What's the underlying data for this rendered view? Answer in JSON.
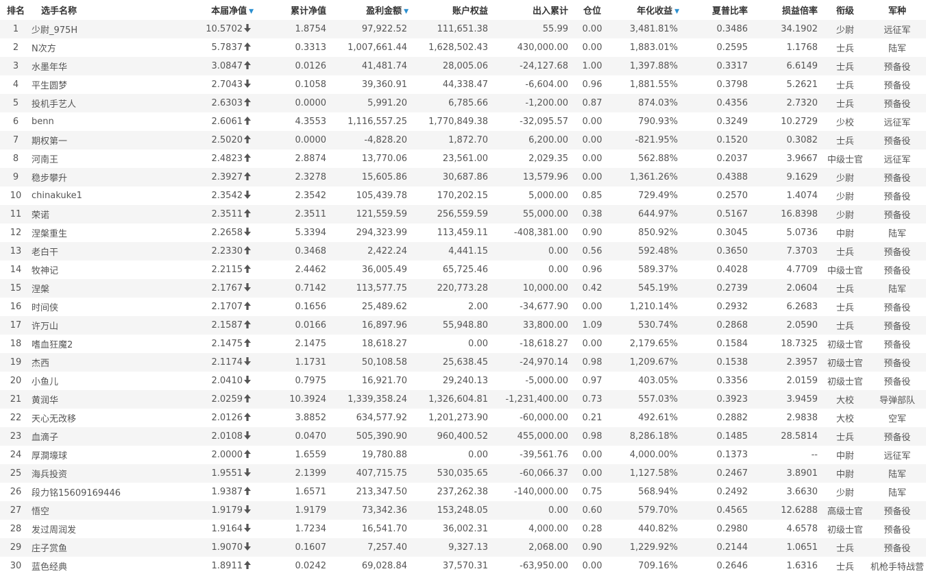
{
  "columns": {
    "rank": "排名",
    "name": "选手名称",
    "nav": "本届净值",
    "cum_nav": "累计净值",
    "profit": "盈利金额",
    "equity": "账户权益",
    "flow": "出入累计",
    "position": "仓位",
    "annual": "年化收益",
    "sharpe": "夏普比率",
    "pl_ratio": "损益倍率",
    "rank_title": "衔级",
    "army": "军种"
  },
  "colors": {
    "up": "#cc1111",
    "down": "#22a022",
    "sort": "#2a8fd0",
    "stripe": "#f5f5f5"
  },
  "rows": [
    {
      "rank": "1",
      "name": "少尉_975H",
      "nav": "10.5702",
      "dir": "down",
      "cum": "1.8754",
      "profit": "97,922.52",
      "equity": "111,651.38",
      "flow": "55.99",
      "pos": "0.00",
      "annual": "3,481.81%",
      "sharpe": "0.3486",
      "pl": "34.1902",
      "title": "少尉",
      "army": "远征军"
    },
    {
      "rank": "2",
      "name": "N次方",
      "nav": "5.7837",
      "dir": "up",
      "cum": "0.3313",
      "profit": "1,007,661.44",
      "equity": "1,628,502.43",
      "flow": "430,000.00",
      "pos": "0.00",
      "annual": "1,883.01%",
      "sharpe": "0.2595",
      "pl": "1.1768",
      "title": "士兵",
      "army": "陆军"
    },
    {
      "rank": "3",
      "name": "水墨年华",
      "nav": "3.0847",
      "dir": "up",
      "cum": "0.0126",
      "profit": "41,481.74",
      "equity": "28,005.06",
      "flow": "-24,127.68",
      "pos": "1.00",
      "annual": "1,397.88%",
      "sharpe": "0.3317",
      "pl": "6.6149",
      "title": "士兵",
      "army": "预备役"
    },
    {
      "rank": "4",
      "name": "平生圆梦",
      "nav": "2.7043",
      "dir": "down",
      "cum": "0.1058",
      "profit": "39,360.91",
      "equity": "44,338.47",
      "flow": "-6,604.00",
      "pos": "0.96",
      "annual": "1,881.55%",
      "sharpe": "0.3798",
      "pl": "5.2621",
      "title": "士兵",
      "army": "预备役"
    },
    {
      "rank": "5",
      "name": "投机手艺人",
      "nav": "2.6303",
      "dir": "up",
      "cum": "0.0000",
      "profit": "5,991.20",
      "equity": "6,785.66",
      "flow": "-1,200.00",
      "pos": "0.87",
      "annual": "874.03%",
      "sharpe": "0.4356",
      "pl": "2.7320",
      "title": "士兵",
      "army": "预备役"
    },
    {
      "rank": "6",
      "name": "benn",
      "nav": "2.6061",
      "dir": "up",
      "cum": "4.3553",
      "profit": "1,116,557.25",
      "equity": "1,770,849.38",
      "flow": "-32,095.57",
      "pos": "0.00",
      "annual": "790.93%",
      "sharpe": "0.3249",
      "pl": "10.2729",
      "title": "少校",
      "army": "远征军"
    },
    {
      "rank": "7",
      "name": "期权第一",
      "nav": "2.5020",
      "dir": "up",
      "cum": "0.0000",
      "profit": "-4,828.20",
      "equity": "1,872.70",
      "flow": "6,200.00",
      "pos": "0.00",
      "annual": "-821.95%",
      "sharpe": "0.1520",
      "pl": "0.3082",
      "title": "士兵",
      "army": "预备役"
    },
    {
      "rank": "8",
      "name": "河南王",
      "nav": "2.4823",
      "dir": "up",
      "cum": "2.8874",
      "profit": "13,770.06",
      "equity": "23,561.00",
      "flow": "2,029.35",
      "pos": "0.00",
      "annual": "562.88%",
      "sharpe": "0.2037",
      "pl": "3.9667",
      "title": "中级士官",
      "army": "远征军"
    },
    {
      "rank": "9",
      "name": "稳步攀升",
      "nav": "2.3927",
      "dir": "up",
      "cum": "2.3278",
      "profit": "15,605.86",
      "equity": "30,687.86",
      "flow": "13,579.96",
      "pos": "0.00",
      "annual": "1,361.26%",
      "sharpe": "0.4388",
      "pl": "9.1629",
      "title": "少尉",
      "army": "预备役"
    },
    {
      "rank": "10",
      "name": "chinakuke1",
      "nav": "2.3542",
      "dir": "down",
      "cum": "2.3542",
      "profit": "105,439.78",
      "equity": "170,202.15",
      "flow": "5,000.00",
      "pos": "0.85",
      "annual": "729.49%",
      "sharpe": "0.2570",
      "pl": "1.4074",
      "title": "少尉",
      "army": "预备役"
    },
    {
      "rank": "11",
      "name": "荣诺",
      "nav": "2.3511",
      "dir": "up",
      "cum": "2.3511",
      "profit": "121,559.59",
      "equity": "256,559.59",
      "flow": "55,000.00",
      "pos": "0.38",
      "annual": "644.97%",
      "sharpe": "0.5167",
      "pl": "16.8398",
      "title": "少尉",
      "army": "预备役"
    },
    {
      "rank": "12",
      "name": "涅槃重生",
      "nav": "2.2658",
      "dir": "down",
      "cum": "5.3394",
      "profit": "294,323.99",
      "equity": "113,459.11",
      "flow": "-408,381.00",
      "pos": "0.90",
      "annual": "850.92%",
      "sharpe": "0.3045",
      "pl": "5.0736",
      "title": "中尉",
      "army": "陆军"
    },
    {
      "rank": "13",
      "name": "老白干",
      "nav": "2.2330",
      "dir": "up",
      "cum": "0.3468",
      "profit": "2,422.24",
      "equity": "4,441.15",
      "flow": "0.00",
      "pos": "0.56",
      "annual": "592.48%",
      "sharpe": "0.3650",
      "pl": "7.3703",
      "title": "士兵",
      "army": "预备役"
    },
    {
      "rank": "14",
      "name": "牧神记",
      "nav": "2.2115",
      "dir": "up",
      "cum": "2.4462",
      "profit": "36,005.49",
      "equity": "65,725.46",
      "flow": "0.00",
      "pos": "0.96",
      "annual": "589.37%",
      "sharpe": "0.4028",
      "pl": "4.7709",
      "title": "中级士官",
      "army": "预备役"
    },
    {
      "rank": "15",
      "name": "涅槃",
      "nav": "2.1767",
      "dir": "down",
      "cum": "0.7142",
      "profit": "113,577.75",
      "equity": "220,773.28",
      "flow": "10,000.00",
      "pos": "0.42",
      "annual": "545.19%",
      "sharpe": "0.2739",
      "pl": "2.0604",
      "title": "士兵",
      "army": "陆军"
    },
    {
      "rank": "16",
      "name": "时间侠",
      "nav": "2.1707",
      "dir": "up",
      "cum": "0.1656",
      "profit": "25,489.62",
      "equity": "2.00",
      "flow": "-34,677.90",
      "pos": "0.00",
      "annual": "1,210.14%",
      "sharpe": "0.2932",
      "pl": "6.2683",
      "title": "士兵",
      "army": "预备役"
    },
    {
      "rank": "17",
      "name": "许万山",
      "nav": "2.1587",
      "dir": "up",
      "cum": "0.0166",
      "profit": "16,897.96",
      "equity": "55,948.80",
      "flow": "33,800.00",
      "pos": "1.09",
      "annual": "530.74%",
      "sharpe": "0.2868",
      "pl": "2.0590",
      "title": "士兵",
      "army": "预备役"
    },
    {
      "rank": "18",
      "name": "嗜血狂魔2",
      "nav": "2.1475",
      "dir": "up",
      "cum": "2.1475",
      "profit": "18,618.27",
      "equity": "0.00",
      "flow": "-18,618.27",
      "pos": "0.00",
      "annual": "2,179.65%",
      "sharpe": "0.1584",
      "pl": "18.7325",
      "title": "初级士官",
      "army": "预备役"
    },
    {
      "rank": "19",
      "name": "杰西",
      "nav": "2.1174",
      "dir": "down",
      "cum": "1.1731",
      "profit": "50,108.58",
      "equity": "25,638.45",
      "flow": "-24,970.14",
      "pos": "0.98",
      "annual": "1,209.67%",
      "sharpe": "0.1538",
      "pl": "2.3957",
      "title": "初级士官",
      "army": "预备役"
    },
    {
      "rank": "20",
      "name": "小鱼儿",
      "nav": "2.0410",
      "dir": "down",
      "cum": "0.7975",
      "profit": "16,921.70",
      "equity": "29,240.13",
      "flow": "-5,000.00",
      "pos": "0.97",
      "annual": "403.05%",
      "sharpe": "0.3356",
      "pl": "2.0159",
      "title": "初级士官",
      "army": "预备役"
    },
    {
      "rank": "21",
      "name": "黄润华",
      "nav": "2.0259",
      "dir": "up",
      "cum": "10.3924",
      "profit": "1,339,358.24",
      "equity": "1,326,604.81",
      "flow": "-1,231,400.00",
      "pos": "0.73",
      "annual": "557.03%",
      "sharpe": "0.3923",
      "pl": "3.9459",
      "title": "大校",
      "army": "导弹部队"
    },
    {
      "rank": "22",
      "name": "天心无改移",
      "nav": "2.0126",
      "dir": "up",
      "cum": "3.8852",
      "profit": "634,577.92",
      "equity": "1,201,273.90",
      "flow": "-60,000.00",
      "pos": "0.21",
      "annual": "492.61%",
      "sharpe": "0.2882",
      "pl": "2.9838",
      "title": "大校",
      "army": "空军"
    },
    {
      "rank": "23",
      "name": "血滴子",
      "nav": "2.0108",
      "dir": "down",
      "cum": "0.0470",
      "profit": "505,390.90",
      "equity": "960,400.52",
      "flow": "455,000.00",
      "pos": "0.98",
      "annual": "8,286.18%",
      "sharpe": "0.1485",
      "pl": "28.5814",
      "title": "士兵",
      "army": "预备役"
    },
    {
      "rank": "24",
      "name": "厚澗壕球",
      "nav": "2.0000",
      "dir": "up",
      "cum": "1.6559",
      "profit": "19,780.88",
      "equity": "0.00",
      "flow": "-39,561.76",
      "pos": "0.00",
      "annual": "4,000.00%",
      "sharpe": "0.1373",
      "pl": "--",
      "title": "中尉",
      "army": "远征军"
    },
    {
      "rank": "25",
      "name": "海兵投资",
      "nav": "1.9551",
      "dir": "down",
      "cum": "2.1399",
      "profit": "407,715.75",
      "equity": "530,035.65",
      "flow": "-60,066.37",
      "pos": "0.00",
      "annual": "1,127.58%",
      "sharpe": "0.2467",
      "pl": "3.8901",
      "title": "中尉",
      "army": "陆军"
    },
    {
      "rank": "26",
      "name": "段力铭15609169446",
      "nav": "1.9387",
      "dir": "up",
      "cum": "1.6571",
      "profit": "213,347.50",
      "equity": "237,262.38",
      "flow": "-140,000.00",
      "pos": "0.75",
      "annual": "568.94%",
      "sharpe": "0.2492",
      "pl": "3.6630",
      "title": "少尉",
      "army": "陆军"
    },
    {
      "rank": "27",
      "name": "悟空",
      "nav": "1.9179",
      "dir": "down",
      "cum": "1.9179",
      "profit": "73,342.36",
      "equity": "153,248.05",
      "flow": "0.00",
      "pos": "0.60",
      "annual": "579.70%",
      "sharpe": "0.4565",
      "pl": "12.6288",
      "title": "高级士官",
      "army": "预备役"
    },
    {
      "rank": "28",
      "name": "发过周润发",
      "nav": "1.9164",
      "dir": "down",
      "cum": "1.7234",
      "profit": "16,541.70",
      "equity": "36,002.31",
      "flow": "4,000.00",
      "pos": "0.28",
      "annual": "440.82%",
      "sharpe": "0.2980",
      "pl": "4.6578",
      "title": "初级士官",
      "army": "预备役"
    },
    {
      "rank": "29",
      "name": "庄子赏鱼",
      "nav": "1.9070",
      "dir": "down",
      "cum": "0.1607",
      "profit": "7,257.40",
      "equity": "9,327.13",
      "flow": "2,068.00",
      "pos": "0.90",
      "annual": "1,229.92%",
      "sharpe": "0.2144",
      "pl": "1.0651",
      "title": "士兵",
      "army": "预备役"
    },
    {
      "rank": "30",
      "name": "蓝色经典",
      "nav": "1.8911",
      "dir": "up",
      "cum": "0.0242",
      "profit": "69,028.84",
      "equity": "37,570.31",
      "flow": "-63,950.00",
      "pos": "0.00",
      "annual": "709.16%",
      "sharpe": "0.2646",
      "pl": "1.6316",
      "title": "士兵",
      "army": "机枪手特战营"
    }
  ]
}
